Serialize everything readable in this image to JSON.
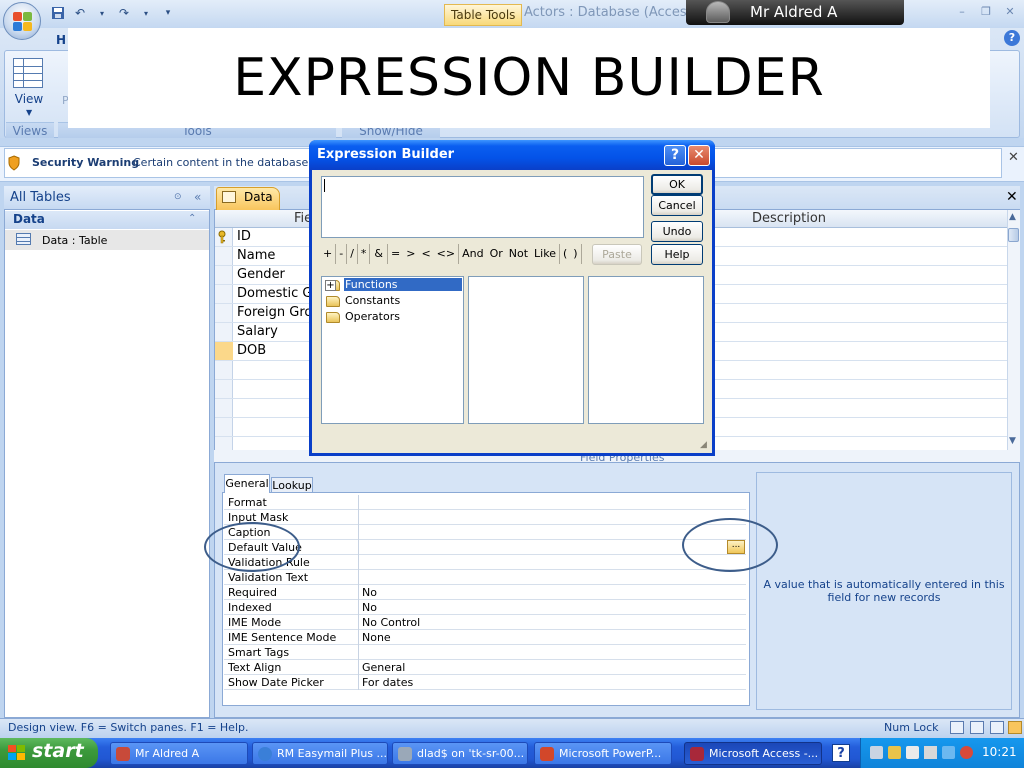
{
  "window": {
    "table_tools": "Table Tools",
    "title": "Actors : Database (Access 2",
    "user_name": "Mr Aldred A"
  },
  "ribbon": {
    "home_tab": "H",
    "view_label": "View",
    "p_label": "P",
    "groups": {
      "views": "Views",
      "tools": "Tools",
      "show_hide": "Show/Hide"
    }
  },
  "overlay_title": "EXPRESSION BUILDER",
  "security": {
    "title": "Security Warning",
    "message": "Certain content in the database ha"
  },
  "nav": {
    "header": "All Tables",
    "group": "Data",
    "items": [
      {
        "label": "Data : Table"
      }
    ]
  },
  "document": {
    "tab_label": "Data",
    "columns": {
      "field": "Fie",
      "description": "Description"
    },
    "fields": [
      "ID",
      "Name",
      "Gender",
      "Domestic Gr",
      "Foreign Gro",
      "Salary",
      "DOB"
    ]
  },
  "field_properties": {
    "title": "Field Properties",
    "tabs": {
      "general": "General",
      "lookup": "Lookup"
    },
    "rows": [
      {
        "name": "Format",
        "value": ""
      },
      {
        "name": "Input Mask",
        "value": ""
      },
      {
        "name": "Caption",
        "value": ""
      },
      {
        "name": "Default Value",
        "value": ""
      },
      {
        "name": "Validation Rule",
        "value": ""
      },
      {
        "name": "Validation Text",
        "value": ""
      },
      {
        "name": "Required",
        "value": "No"
      },
      {
        "name": "Indexed",
        "value": "No"
      },
      {
        "name": "IME Mode",
        "value": "No Control"
      },
      {
        "name": "IME Sentence Mode",
        "value": "None"
      },
      {
        "name": "Smart Tags",
        "value": ""
      },
      {
        "name": "Text Align",
        "value": "General"
      },
      {
        "name": "Show Date Picker",
        "value": "For dates"
      }
    ],
    "builder_button": "...",
    "help_text": "A value that is automatically entered in this field for new records"
  },
  "dialog": {
    "title": "Expression Builder",
    "help_button": "?",
    "close_button": "✕",
    "buttons": {
      "ok": "OK",
      "cancel": "Cancel",
      "undo": "Undo",
      "paste": "Paste",
      "help": "Help"
    },
    "operators": [
      "+",
      "-",
      "/",
      "*",
      "&",
      "=",
      ">",
      "<",
      "<>",
      "And",
      "Or",
      "Not",
      "Like",
      "(",
      ")"
    ],
    "tree": [
      {
        "label": "Functions",
        "expandable": true,
        "selected": true
      },
      {
        "label": "Constants",
        "expandable": false,
        "selected": false
      },
      {
        "label": "Operators",
        "expandable": false,
        "selected": false
      }
    ]
  },
  "status": {
    "text": "Design view.  F6 = Switch panes.  F1 = Help.",
    "num_lock": "Num Lock"
  },
  "taskbar": {
    "start": "start",
    "tasks": [
      {
        "label": "Mr Aldred A"
      },
      {
        "label": "RM Easymail Plus ..."
      },
      {
        "label": "dlad$ on 'tk-sr-00..."
      },
      {
        "label": "Microsoft PowerP..."
      },
      {
        "label": "Microsoft Access -..."
      }
    ],
    "help_icon": "?",
    "clock": "10:21"
  },
  "icons": {
    "office": "office-button-icon",
    "save": "save-icon",
    "undo": "undo-icon",
    "redo": "redo-icon",
    "shield": "shield-icon",
    "key": "primary-key-icon",
    "folder": "folder-icon"
  }
}
